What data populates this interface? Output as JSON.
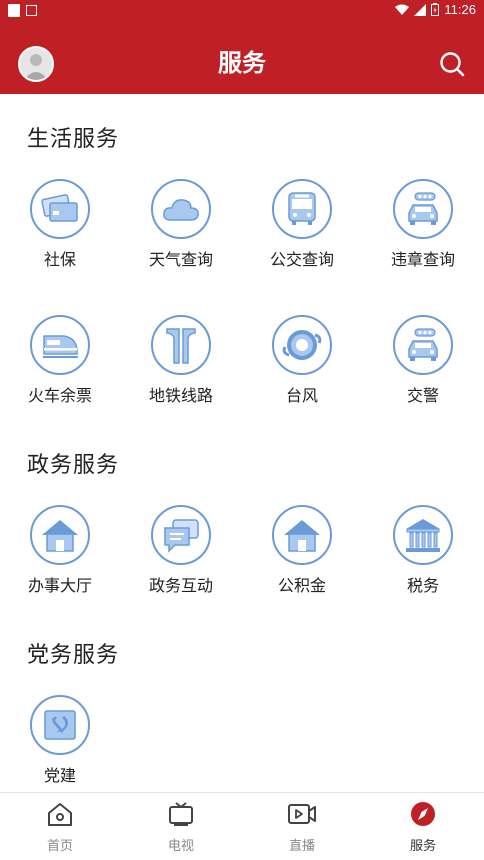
{
  "status_bar": {
    "time": "11:26"
  },
  "header": {
    "title": "服务"
  },
  "sections": [
    {
      "title": "生活服务",
      "items": [
        {
          "label": "社保",
          "icon": "card-icon"
        },
        {
          "label": "天气查询",
          "icon": "cloud-icon"
        },
        {
          "label": "公交查询",
          "icon": "bus-icon"
        },
        {
          "label": "违章查询",
          "icon": "car-icon"
        },
        {
          "label": "火车余票",
          "icon": "train-icon"
        },
        {
          "label": "地铁线路",
          "icon": "subway-icon"
        },
        {
          "label": "台风",
          "icon": "typhoon-icon"
        },
        {
          "label": "交警",
          "icon": "police-car-icon"
        }
      ]
    },
    {
      "title": "政务服务",
      "items": [
        {
          "label": "办事大厅",
          "icon": "house-icon"
        },
        {
          "label": "政务互动",
          "icon": "chat-icon"
        },
        {
          "label": "公积金",
          "icon": "house-icon"
        },
        {
          "label": "税务",
          "icon": "bank-icon"
        }
      ]
    },
    {
      "title": "党务服务",
      "items": [
        {
          "label": "党建",
          "icon": "party-flag-icon"
        }
      ]
    }
  ],
  "tabbar": {
    "items": [
      {
        "label": "首页",
        "icon": "home-icon",
        "active": false
      },
      {
        "label": "电视",
        "icon": "tv-icon",
        "active": false
      },
      {
        "label": "直播",
        "icon": "live-icon",
        "active": false
      },
      {
        "label": "服务",
        "icon": "compass-icon",
        "active": true
      }
    ]
  },
  "colors": {
    "brand_red": "#bf2026",
    "icon_blue": "#6a9ad8",
    "icon_fill": "#a9c8ef"
  }
}
